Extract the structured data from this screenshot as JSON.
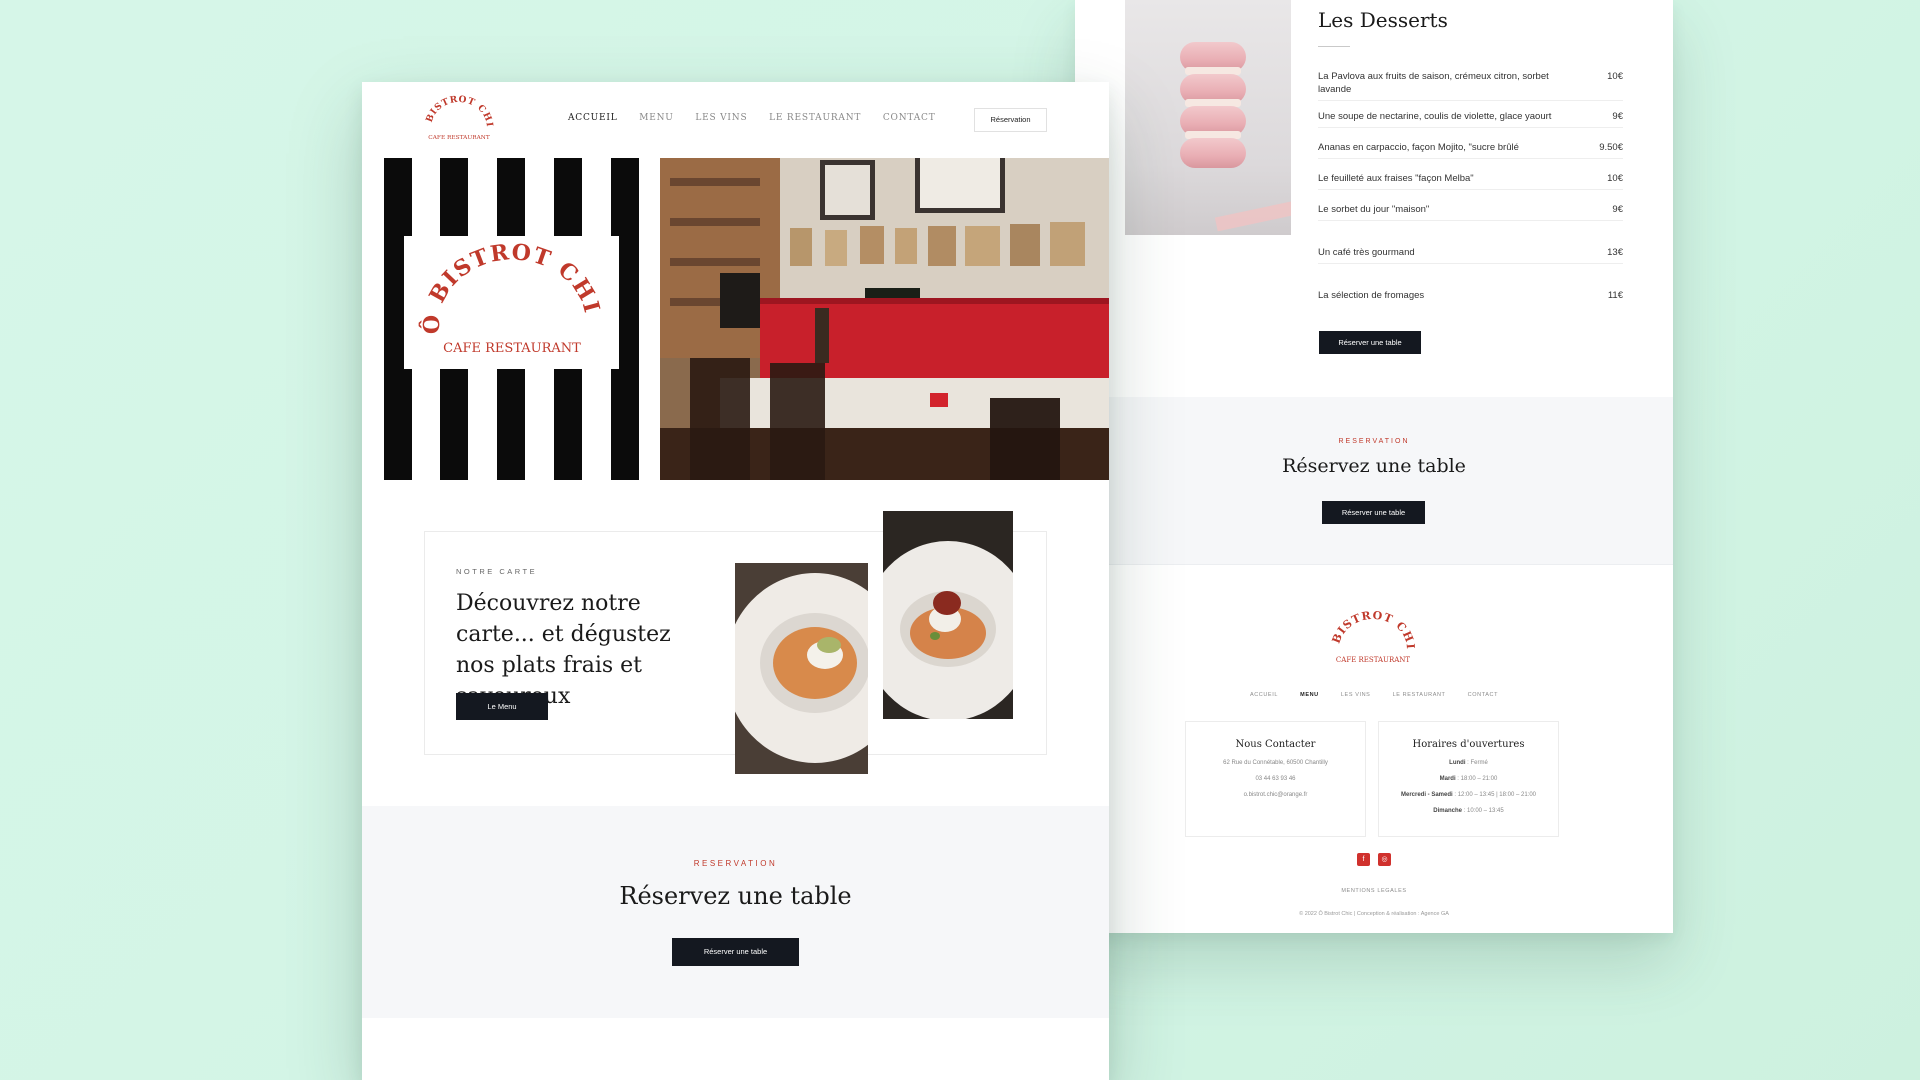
{
  "colors": {
    "background": "#d3f5e6",
    "brand_red": "#c0392b",
    "dark_button": "#141820",
    "section_grey": "#f6f7f9"
  },
  "brand": {
    "name": "Ô BISTROT CHIC",
    "subtitle": "CAFE RESTAURANT"
  },
  "header": {
    "nav": [
      "ACCUEIL",
      "MENU",
      "LES VINS",
      "LE RESTAURANT",
      "CONTACT"
    ],
    "active": "ACCUEIL",
    "reservation_label": "Réservation"
  },
  "carte": {
    "kicker": "NOTRE CARTE",
    "title": "Découvrez notre carte... et dégustez nos plats frais et savoureux",
    "button_label": "Le Menu"
  },
  "front_reservation": {
    "kicker": "RESERVATION",
    "title": "Réservez une table",
    "button_label": "Réserver une table"
  },
  "desserts": {
    "title": "Les Desserts",
    "items": [
      {
        "name": "La Pavlova aux fruits de saison, crémeux citron, sorbet lavande",
        "price": "10€"
      },
      {
        "name": "Une soupe de nectarine, coulis de violette, glace yaourt",
        "price": "9€"
      },
      {
        "name": "Ananas en carpaccio, façon Mojito, \"sucre brûlé",
        "price": "9.50€"
      },
      {
        "name": "Le feuilleté aux fraises \"façon Melba\"",
        "price": "10€"
      },
      {
        "name": "Le sorbet du jour \"maison\"",
        "price": "9€"
      },
      {
        "name": "Un café très gourmand",
        "price": "13€"
      },
      {
        "name": "La sélection de fromages",
        "price": "11€"
      }
    ],
    "button_label": "Réserver une table"
  },
  "back_reservation": {
    "kicker": "RESERVATION",
    "title": "Réservez une table",
    "button_label": "Réserver une table"
  },
  "footer": {
    "nav": [
      "ACCUEIL",
      "MENU",
      "LES VINS",
      "LE RESTAURANT",
      "CONTACT"
    ],
    "active": "MENU",
    "contact": {
      "title": "Nous Contacter",
      "address": "62 Rue du Connétable, 60500 Chantilly",
      "phone": "03 44 63 93 46",
      "email": "o.bistrot.chic@orange.fr"
    },
    "hours": {
      "title": "Horaires d'ouvertures",
      "rows": [
        {
          "day": "Lundi",
          "time": "Fermé"
        },
        {
          "day": "Mardi",
          "time": "18:00 – 21:00"
        },
        {
          "day": "Mercredi - Samedi",
          "time": "12:00 – 13:45 | 18:00 – 21:00"
        },
        {
          "day": "Dimanche",
          "time": "10:00 – 13:45"
        }
      ]
    },
    "social": [
      "facebook-icon",
      "instagram-icon"
    ],
    "legal": "MENTIONS LEGALES",
    "copyright": "© 2022 Ô Bistrot Chic | Conception & réalisation : Agence GA"
  }
}
